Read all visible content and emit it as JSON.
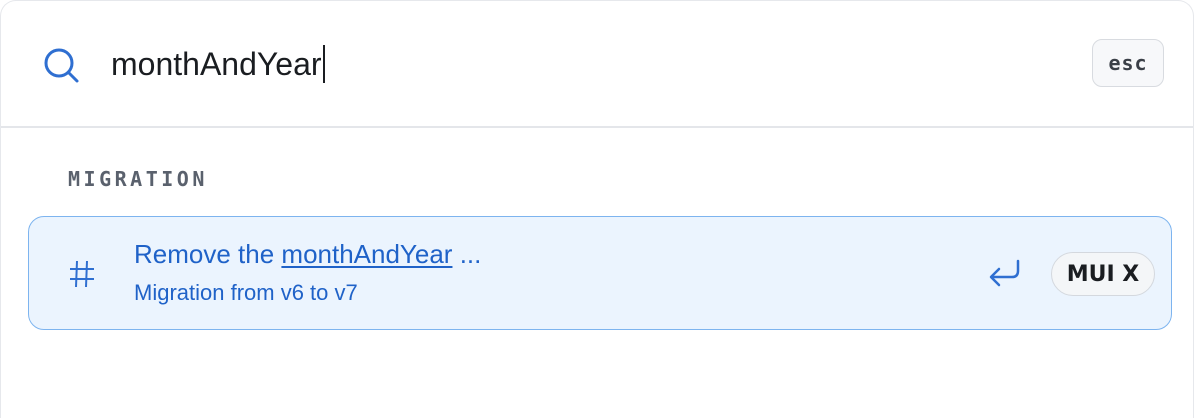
{
  "search": {
    "query": "monthAndYear",
    "close_key": "esc"
  },
  "results": {
    "section_label": "MIGRATION",
    "items": [
      {
        "title_prefix": "Remove the ",
        "title_match": "monthAndYear",
        "title_suffix": " ...",
        "subtitle": "Migration from v6 to v7",
        "product": "MUI X",
        "icon": "hash-icon",
        "action_icon": "enter-icon"
      }
    ]
  },
  "colors": {
    "accent": "#1f62c8",
    "selected_bg": "#ebf4fe",
    "selected_border": "#7db4ef"
  }
}
